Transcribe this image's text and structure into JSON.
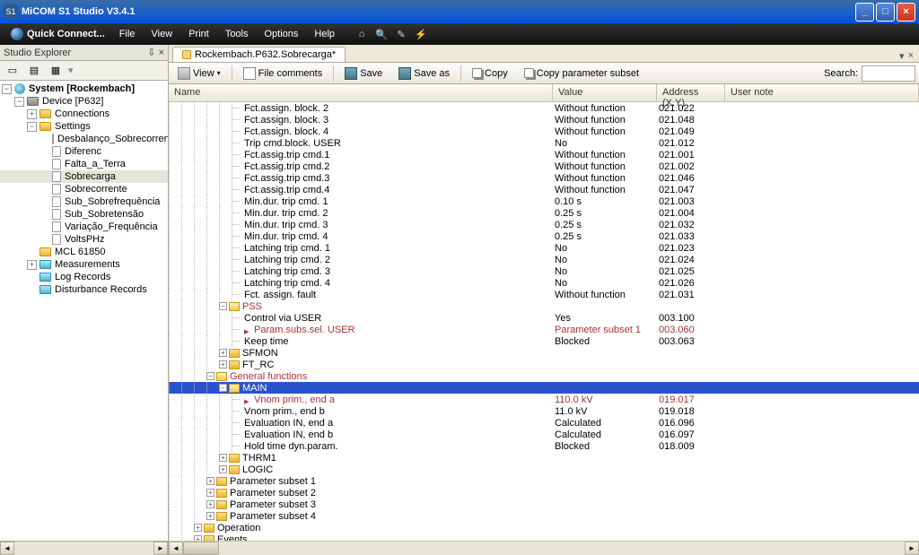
{
  "window": {
    "title": "MiCOM S1 Studio V3.4.1"
  },
  "quickconnect": "Quick Connect...",
  "menu": [
    "File",
    "View",
    "Print",
    "Tools",
    "Options",
    "Help"
  ],
  "explorer": {
    "title": "Studio Explorer",
    "root": "System [Rockembach]",
    "device": "Device [P632]",
    "connections": "Connections",
    "settings": "Settings",
    "settings_children": [
      "Desbalanço_Sobrecorrente",
      "Diferenc",
      "Falta_a_Terra",
      "Sobrecarga",
      "Sobrecorrente",
      "Sub_Sobrefrequência",
      "Sub_Sobretensão",
      "Variação_Frequência",
      "VoltsPHz"
    ],
    "mcl": "MCL 61850",
    "measurements": "Measurements",
    "log": "Log Records",
    "disturb": "Disturbance Records"
  },
  "tab": "Rockembach.P632.Sobrecarga*",
  "toolbar": {
    "view": "View",
    "comments": "File comments",
    "save": "Save",
    "saveas": "Save as",
    "copy": "Copy",
    "copyparams": "Copy parameter subset",
    "search": "Search:"
  },
  "columns": {
    "name": "Name",
    "value": "Value",
    "addr": "Address (X.Y)",
    "note": "User note"
  },
  "rows": [
    {
      "indent": 5,
      "name": "Fct.assign. block. 2",
      "value": "Without function",
      "addr": "021.022"
    },
    {
      "indent": 5,
      "name": "Fct.assign. block. 3",
      "value": "Without function",
      "addr": "021.048"
    },
    {
      "indent": 5,
      "name": "Fct.assign. block. 4",
      "value": "Without function",
      "addr": "021.049"
    },
    {
      "indent": 5,
      "name": "Trip cmd.block. USER",
      "value": "No",
      "addr": "021.012"
    },
    {
      "indent": 5,
      "name": "Fct.assig.trip cmd.1",
      "value": "Without function",
      "addr": "021.001"
    },
    {
      "indent": 5,
      "name": "Fct.assig.trip cmd.2",
      "value": "Without function",
      "addr": "021.002"
    },
    {
      "indent": 5,
      "name": "Fct.assig.trip cmd.3",
      "value": "Without function",
      "addr": "021.046"
    },
    {
      "indent": 5,
      "name": "Fct.assig.trip cmd.4",
      "value": "Without function",
      "addr": "021.047"
    },
    {
      "indent": 5,
      "name": "Min.dur. trip cmd. 1",
      "value": "0.10 s",
      "addr": "021.003"
    },
    {
      "indent": 5,
      "name": "Min.dur. trip cmd. 2",
      "value": "0.25 s",
      "addr": "021.004"
    },
    {
      "indent": 5,
      "name": "Min.dur. trip cmd. 3",
      "value": "0.25 s",
      "addr": "021.032"
    },
    {
      "indent": 5,
      "name": "Min.dur. trip cmd. 4",
      "value": "0.25 s",
      "addr": "021.033"
    },
    {
      "indent": 5,
      "name": "Latching trip cmd. 1",
      "value": "No",
      "addr": "021.023"
    },
    {
      "indent": 5,
      "name": "Latching trip cmd. 2",
      "value": "No",
      "addr": "021.024"
    },
    {
      "indent": 5,
      "name": "Latching trip cmd. 3",
      "value": "No",
      "addr": "021.025"
    },
    {
      "indent": 5,
      "name": "Latching trip cmd. 4",
      "value": "No",
      "addr": "021.026"
    },
    {
      "indent": 5,
      "name": "Fct. assign. fault",
      "value": "Without function",
      "addr": "021.031"
    },
    {
      "indent": 4,
      "name": "PSS",
      "folder": "open",
      "red": true
    },
    {
      "indent": 5,
      "name": "Control via USER",
      "value": "Yes",
      "addr": "003.100"
    },
    {
      "indent": 5,
      "name": "Param.subs.sel. USER",
      "value": "Parameter subset 1",
      "addr": "003.060",
      "red": true,
      "mark": true
    },
    {
      "indent": 5,
      "name": "Keep time",
      "value": "Blocked",
      "addr": "003.063"
    },
    {
      "indent": 4,
      "name": "SFMON",
      "folder": "closed"
    },
    {
      "indent": 4,
      "name": "FT_RC",
      "folder": "closed"
    },
    {
      "indent": 3,
      "name": "General functions",
      "folder": "open",
      "red": true
    },
    {
      "indent": 4,
      "name": "MAIN",
      "folder": "open",
      "red": true,
      "selected": true
    },
    {
      "indent": 5,
      "name": "Vnom prim., end a",
      "value": "110.0 kV",
      "addr": "019.017",
      "red": true,
      "mark": true
    },
    {
      "indent": 5,
      "name": "Vnom prim., end b",
      "value": "11.0 kV",
      "addr": "019.018"
    },
    {
      "indent": 5,
      "name": "Evaluation IN, end a",
      "value": "Calculated",
      "addr": "016.096"
    },
    {
      "indent": 5,
      "name": "Evaluation IN, end b",
      "value": "Calculated",
      "addr": "016.097"
    },
    {
      "indent": 5,
      "name": "Hold time dyn.param.",
      "value": "Blocked",
      "addr": "018.009"
    },
    {
      "indent": 4,
      "name": "THRM1",
      "folder": "closed"
    },
    {
      "indent": 4,
      "name": "LOGIC",
      "folder": "closed"
    },
    {
      "indent": 3,
      "name": "Parameter subset 1",
      "folder": "closed"
    },
    {
      "indent": 3,
      "name": "Parameter subset 2",
      "folder": "closed"
    },
    {
      "indent": 3,
      "name": "Parameter subset 3",
      "folder": "closed"
    },
    {
      "indent": 3,
      "name": "Parameter subset 4",
      "folder": "closed"
    },
    {
      "indent": 2,
      "name": "Operation",
      "folder": "closed"
    },
    {
      "indent": 2,
      "name": "Events",
      "folder": "closed"
    }
  ]
}
